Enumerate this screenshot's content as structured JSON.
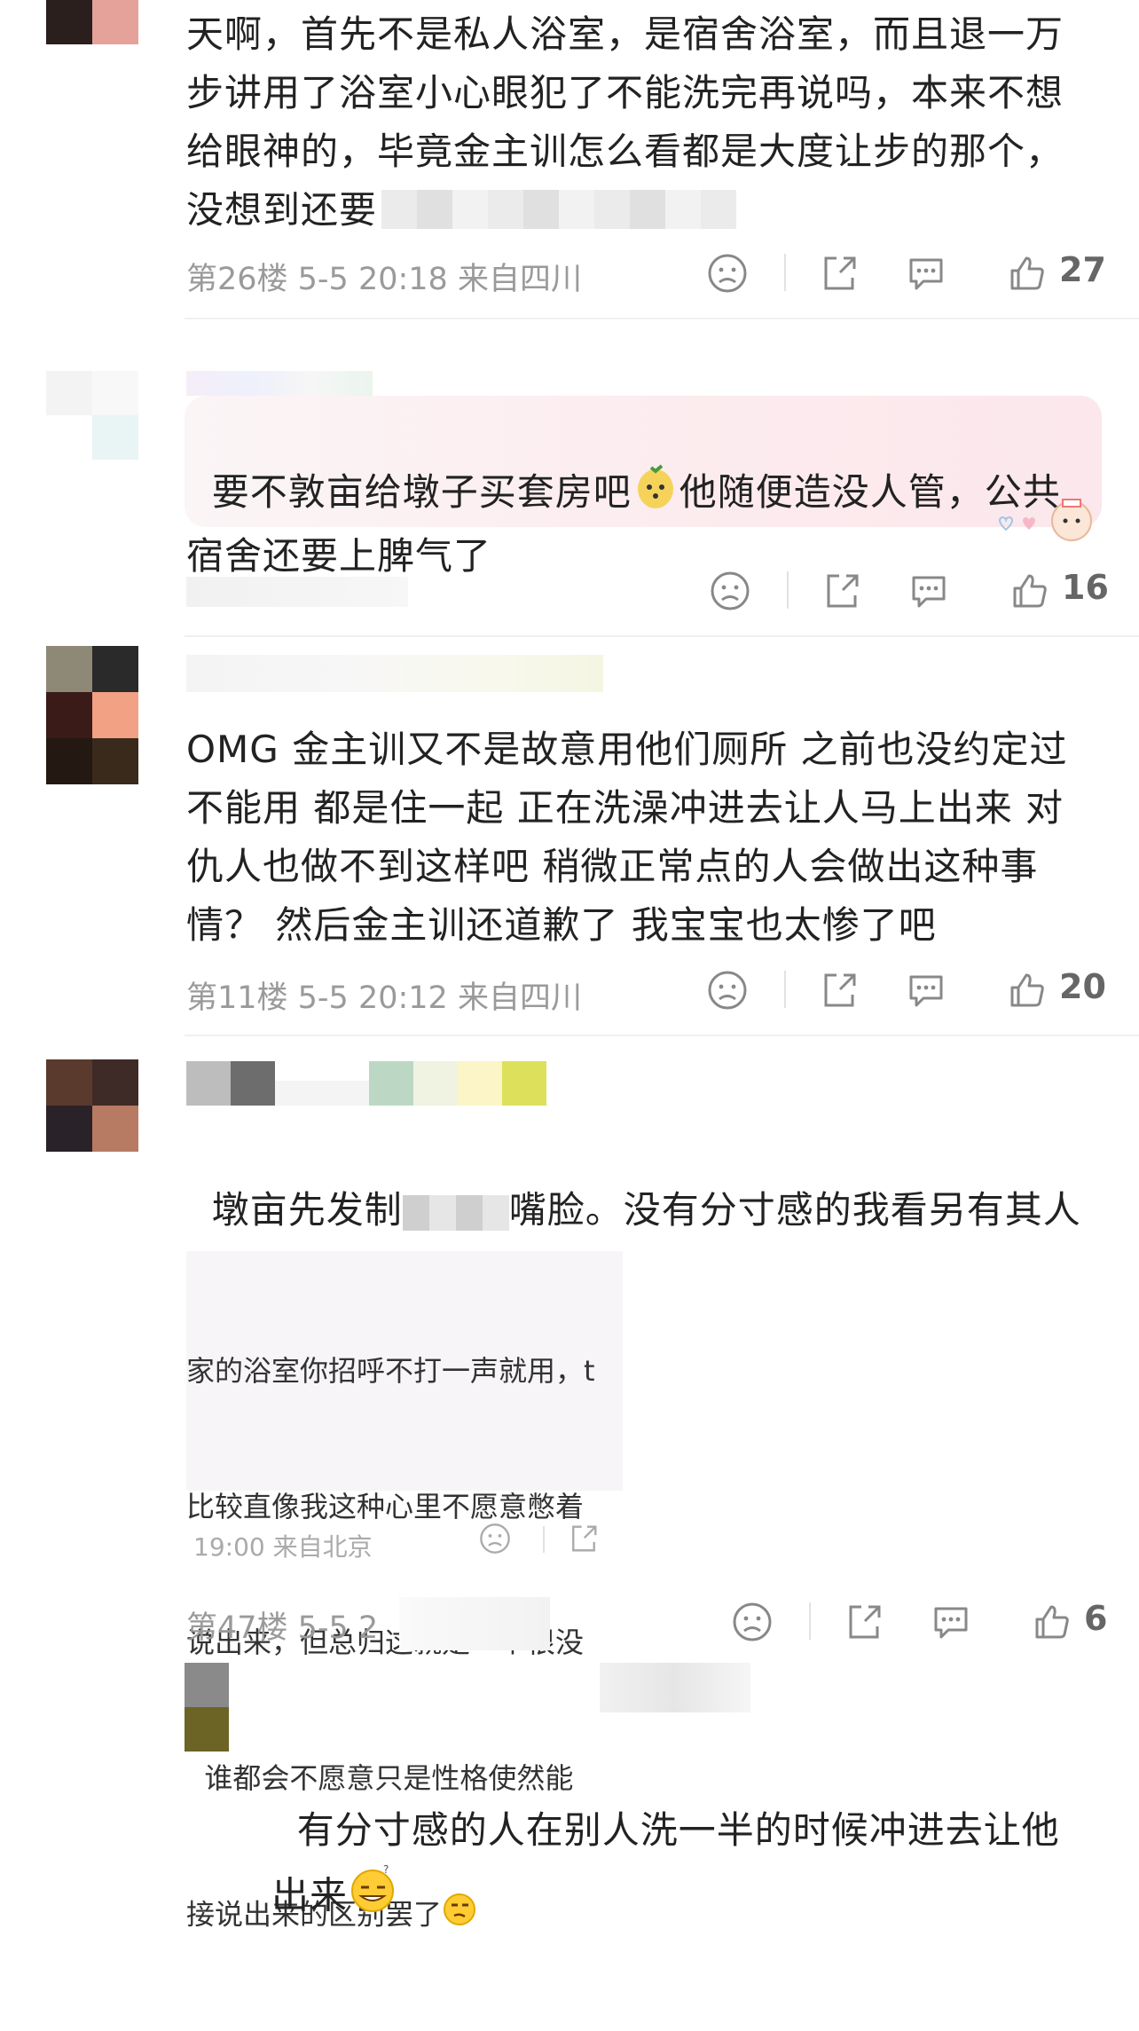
{
  "comments": [
    {
      "text": "天啊，首先不是私人浴室，是宿舍浴室，而且退一万\n步讲用了浴室小心眼犯了不能洗完再说吗，本来不想\n给眼神的，毕竟金主训怎么看都是大度让步的那个，\n没想到还要",
      "meta": "第26楼  5-5 20:18  来自四川",
      "likes": "27"
    },
    {
      "text": "要不敦亩给墩子买套房吧",
      "text2": "他随便造没人管，公共\n宿舍还要上脾气了",
      "likes": "16"
    },
    {
      "text": "OMG 金主训又不是故意用他们厕所 之前也没约定过\n不能用 都是住一起 正在洗澡冲进去让人马上出来 对\n仇人也做不到这样吧 稍微正常点的人会做出这种事\n情？ 然后金主训还道歉了 我宝宝也太惨了吧",
      "meta": "第11楼  5-5 20:12  来自四川",
      "likes": "20"
    },
    {
      "text_a": "墩亩先发制",
      "text_b": "嘴脸。没有分寸感的我看另有其人",
      "quote": {
        "lines": [
          "家的浴室你招呼不打一声就用，t",
          "比较直像我这种心里不愿意憋着",
          "说出来，但总归这就是一个很没",
          "  谁都会不愿意只是性格使然能",
          "接说出来的区别罢了"
        ],
        "meta": "19:00 来自北京"
      },
      "meta": "第47楼  5-5 2",
      "likes": "6"
    },
    {
      "text": "有分寸感的人在别人洗一半的时候冲进去让他\n出来"
    }
  ],
  "icons": {
    "dislike": "sad-face-icon",
    "share": "share-icon",
    "comment": "comment-icon",
    "like": "thumbs-up-icon"
  }
}
